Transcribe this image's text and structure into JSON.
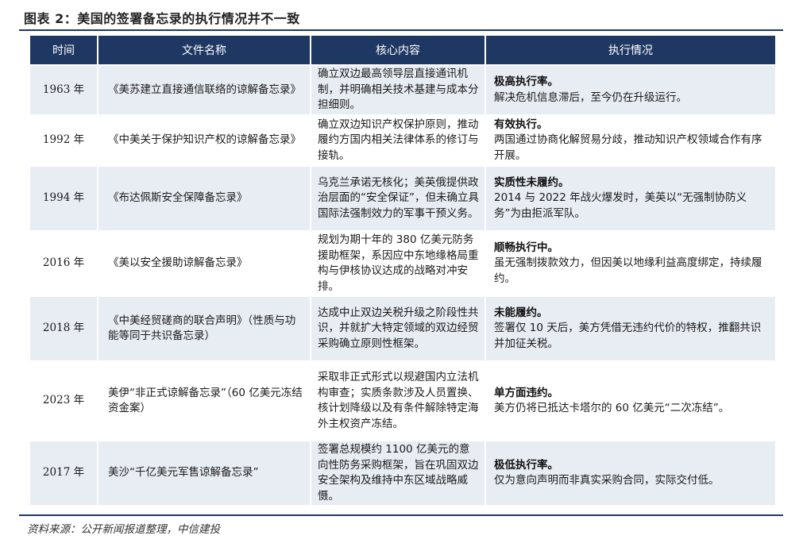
{
  "figure": {
    "title": "图表 2：美国的签署备忘录的执行情况并不一致",
    "source": "资料来源：公开新闻报道整理，中信建投"
  },
  "table": {
    "headers": [
      "时间",
      "文件名称",
      "核心内容",
      "执行情况"
    ],
    "rows": [
      {
        "time": "1963 年",
        "name": "《美苏建立直接通信联络的谅解备忘录》",
        "content": "确立双边最高领导层直接通讯机制，并明确相关技术基建与成本分担细则。",
        "exec_head": "极高执行率。",
        "exec_body": "解决危机信息滞后，至今仍在升级运行。"
      },
      {
        "time": "1992 年",
        "name": "《中美关于保护知识产权的谅解备忘录》",
        "content": "确立双边知识产权保护原则，推动履约方国内相关法律体系的修订与接轨。",
        "exec_head": "有效执行。",
        "exec_body": "两国通过协商化解贸易分歧，推动知识产权领域合作有序开展。"
      },
      {
        "time": "1994 年",
        "name": "《布达佩斯安全保障备忘录》",
        "content": "乌克兰承诺无核化；美英俄提供政治层面的“安全保证”，但未确立具国际法强制效力的军事干预义务。",
        "exec_head": "实质性未履约。",
        "exec_body": "2014 与 2022 年战火爆发时，美英以“无强制协防义务”为由拒派军队。"
      },
      {
        "time": "2016 年",
        "name": "《美以安全援助谅解备忘录》",
        "content": "规划为期十年的 380 亿美元防务援助框架，系因应中东地缘格局重构与伊核协议达成的战略对冲安排。",
        "exec_head": "顺畅执行中。",
        "exec_body": "虽无强制拨款效力，但因美以地缘利益高度绑定，持续履约。"
      },
      {
        "time": "2018 年",
        "name": "《中美经贸磋商的联合声明》（性质与功能等同于共识备忘录）",
        "content": "达成中止双边关税升级之阶段性共识，并就扩大特定领域的双边经贸采购确立原则性框架。",
        "exec_head": "未能履约。",
        "exec_body": "签署仅 10 天后，美方凭借无违约代价的特权，推翻共识并加征关税。"
      },
      {
        "time": "2023 年",
        "name": "美伊“非正式谅解备忘录”（60 亿美元冻结资金案）",
        "content": "采取非正式形式以规避国内立法机构审查；实质条款涉及人员置换、核计划降级以及有条件解除特定海外主权资产冻结。",
        "exec_head": "单方面违约。",
        "exec_body": "美方仍将已抵达卡塔尔的 60 亿美元“二次冻结”。"
      },
      {
        "time": "2017 年",
        "name": "美沙“千亿美元军售谅解备忘录”",
        "content": "签署总规模约 1100 亿美元的意向性防务采购框架，旨在巩固双边安全架构及维持中东区域战略威慑。",
        "exec_head": "极低执行率。",
        "exec_body": "仅为意向声明而非真实采购合同，实际交付低。"
      }
    ]
  }
}
